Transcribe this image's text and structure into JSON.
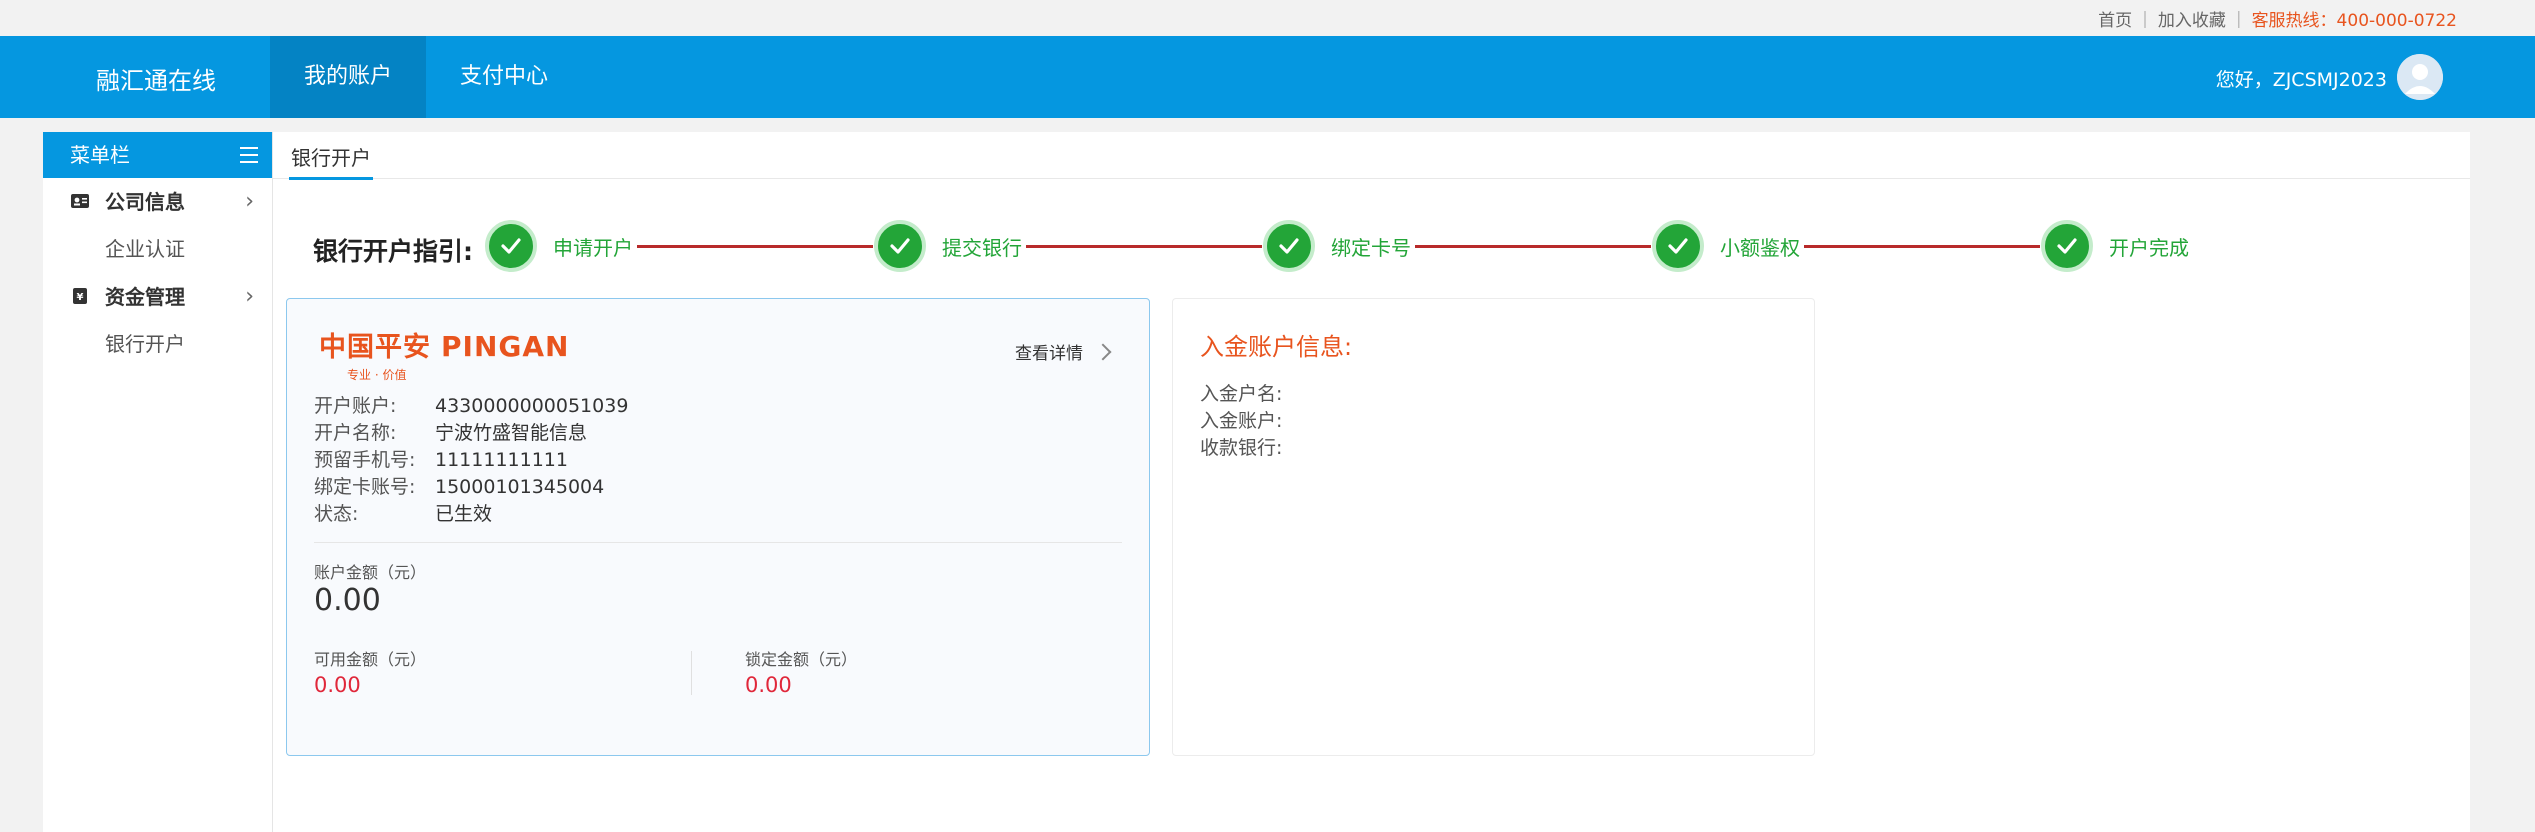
{
  "toplinks": {
    "home": "首页",
    "favorite": "加入收藏",
    "hotline": "客服热线：400-000-0722"
  },
  "header": {
    "logo": "融汇通在线",
    "nav": [
      {
        "label": "我的账户",
        "active": true
      },
      {
        "label": "支付中心",
        "active": false
      }
    ],
    "greeting": "您好，ZJCSMJ2023"
  },
  "sidebar": {
    "title": "菜单栏",
    "groups": [
      {
        "label": "公司信息",
        "icon": "id-card-icon",
        "items": [
          "企业认证"
        ]
      },
      {
        "label": "资金管理",
        "icon": "money-bag-icon",
        "items": [
          "银行开户"
        ]
      }
    ]
  },
  "tab": {
    "label": "银行开户"
  },
  "guide": {
    "title": "银行开户指引:",
    "steps": [
      "申请开户",
      "提交银行",
      "绑定卡号",
      "小额鉴权",
      "开户完成"
    ]
  },
  "account_card": {
    "bank_name_cn": "中国平安",
    "bank_name_en": "PINGAN",
    "bank_slogan": "专业 · 价值",
    "detail_link": "查看详情",
    "fields": [
      {
        "key": "开户账户:",
        "value": "4330000000051039"
      },
      {
        "key": "开户名称:",
        "value": "宁波竹盛智能信息"
      },
      {
        "key": "预留手机号:",
        "value": "11111111111"
      },
      {
        "key": "绑定卡账号:",
        "value": "15000101345004"
      },
      {
        "key": "状态:",
        "value": "已生效"
      }
    ],
    "balance_label": "账户金额（元）",
    "balance_value": "0.00",
    "available_label": "可用金额（元）",
    "available_value": "0.00",
    "locked_label": "锁定金额（元）",
    "locked_value": "0.00"
  },
  "deposit_card": {
    "title": "入金账户信息:",
    "fields": [
      "入金户名:",
      "入金账户:",
      "收款银行:"
    ]
  },
  "colors": {
    "primary": "#0597e0",
    "step_green": "#23a538",
    "step_line": "#b82a2a",
    "accent_orange": "#e8541e",
    "amount_red": "#e0273a"
  }
}
